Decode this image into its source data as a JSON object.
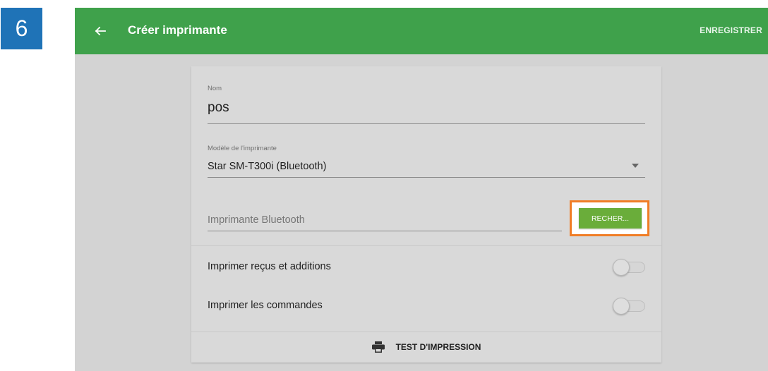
{
  "step": {
    "number": "6",
    "color": "#1f73b7"
  },
  "appbar": {
    "back_icon": "arrow-left-icon",
    "title": "Créer imprimante",
    "save_label": "ENREGISTRER",
    "color": "#3fa14b"
  },
  "form": {
    "name": {
      "label": "Nom",
      "value": "pos"
    },
    "model": {
      "label": "Modèle de l'imprimante",
      "value": "Star SM-T300i (Bluetooth)",
      "icon": "caret-down-icon"
    },
    "bluetooth": {
      "placeholder": "Imprimante Bluetooth",
      "search_label": "RECHER...",
      "search_color": "#6aad3a",
      "highlight_color": "#f07d26"
    },
    "toggles": [
      {
        "label": "Imprimer reçus et additions",
        "on": false
      },
      {
        "label": "Imprimer les commandes",
        "on": false
      }
    ],
    "test_print": {
      "icon": "printer-icon",
      "label": "TEST D'IMPRESSION"
    }
  }
}
